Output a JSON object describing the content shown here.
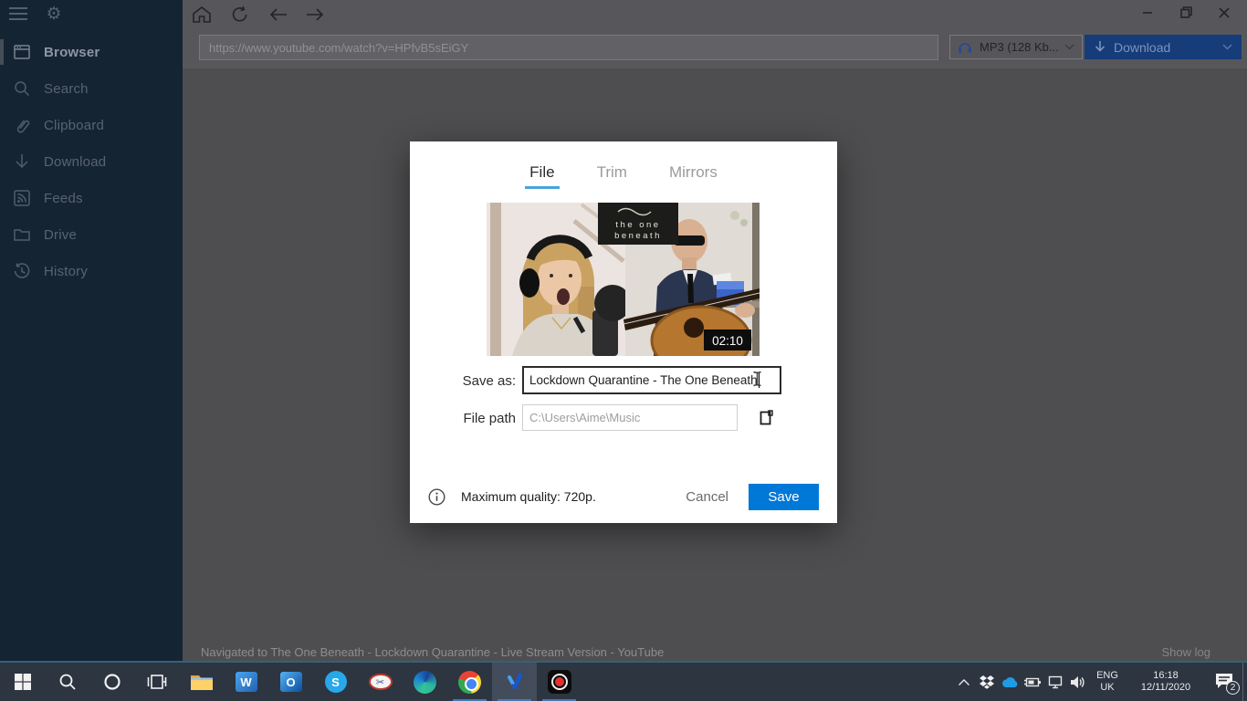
{
  "sidebar": {
    "items": [
      {
        "label": "Browser",
        "active": true
      },
      {
        "label": "Search"
      },
      {
        "label": "Clipboard"
      },
      {
        "label": "Download"
      },
      {
        "label": "Feeds"
      },
      {
        "label": "Drive"
      },
      {
        "label": "History"
      }
    ]
  },
  "toolbar": {
    "url": "https://www.youtube.com/watch?v=HPfvB5sEiGY",
    "format_label": "MP3 (128 Kb...",
    "download_label": "Download"
  },
  "dialog": {
    "tabs": [
      {
        "label": "File",
        "active": true
      },
      {
        "label": "Trim"
      },
      {
        "label": "Mirrors"
      }
    ],
    "video": {
      "overlay_line1": "the one",
      "overlay_line2": "beneath",
      "duration": "02:10"
    },
    "save_as_label": "Save as:",
    "save_as_value": "Lockdown Quarantine - The One Beneath",
    "file_path_label": "File path",
    "file_path_value": "C:\\Users\\Aime\\Music",
    "info_text": "Maximum quality: 720p.",
    "cancel_label": "Cancel",
    "save_label": "Save"
  },
  "statusbar": {
    "message": "Navigated to The One Beneath - Lockdown Quarantine - Live Stream Version - YouTube",
    "show_log": "Show log"
  },
  "taskbar": {
    "tray": {
      "lang_top": "ENG",
      "lang_bottom": "UK",
      "time": "16:18",
      "date": "12/11/2020",
      "notification_count": "2"
    }
  },
  "colors": {
    "accent_blue": "#0078d7",
    "tab_underline": "#45a3dc",
    "sidebar_bg": "#152433",
    "taskbar_bg": "#2d3541"
  }
}
